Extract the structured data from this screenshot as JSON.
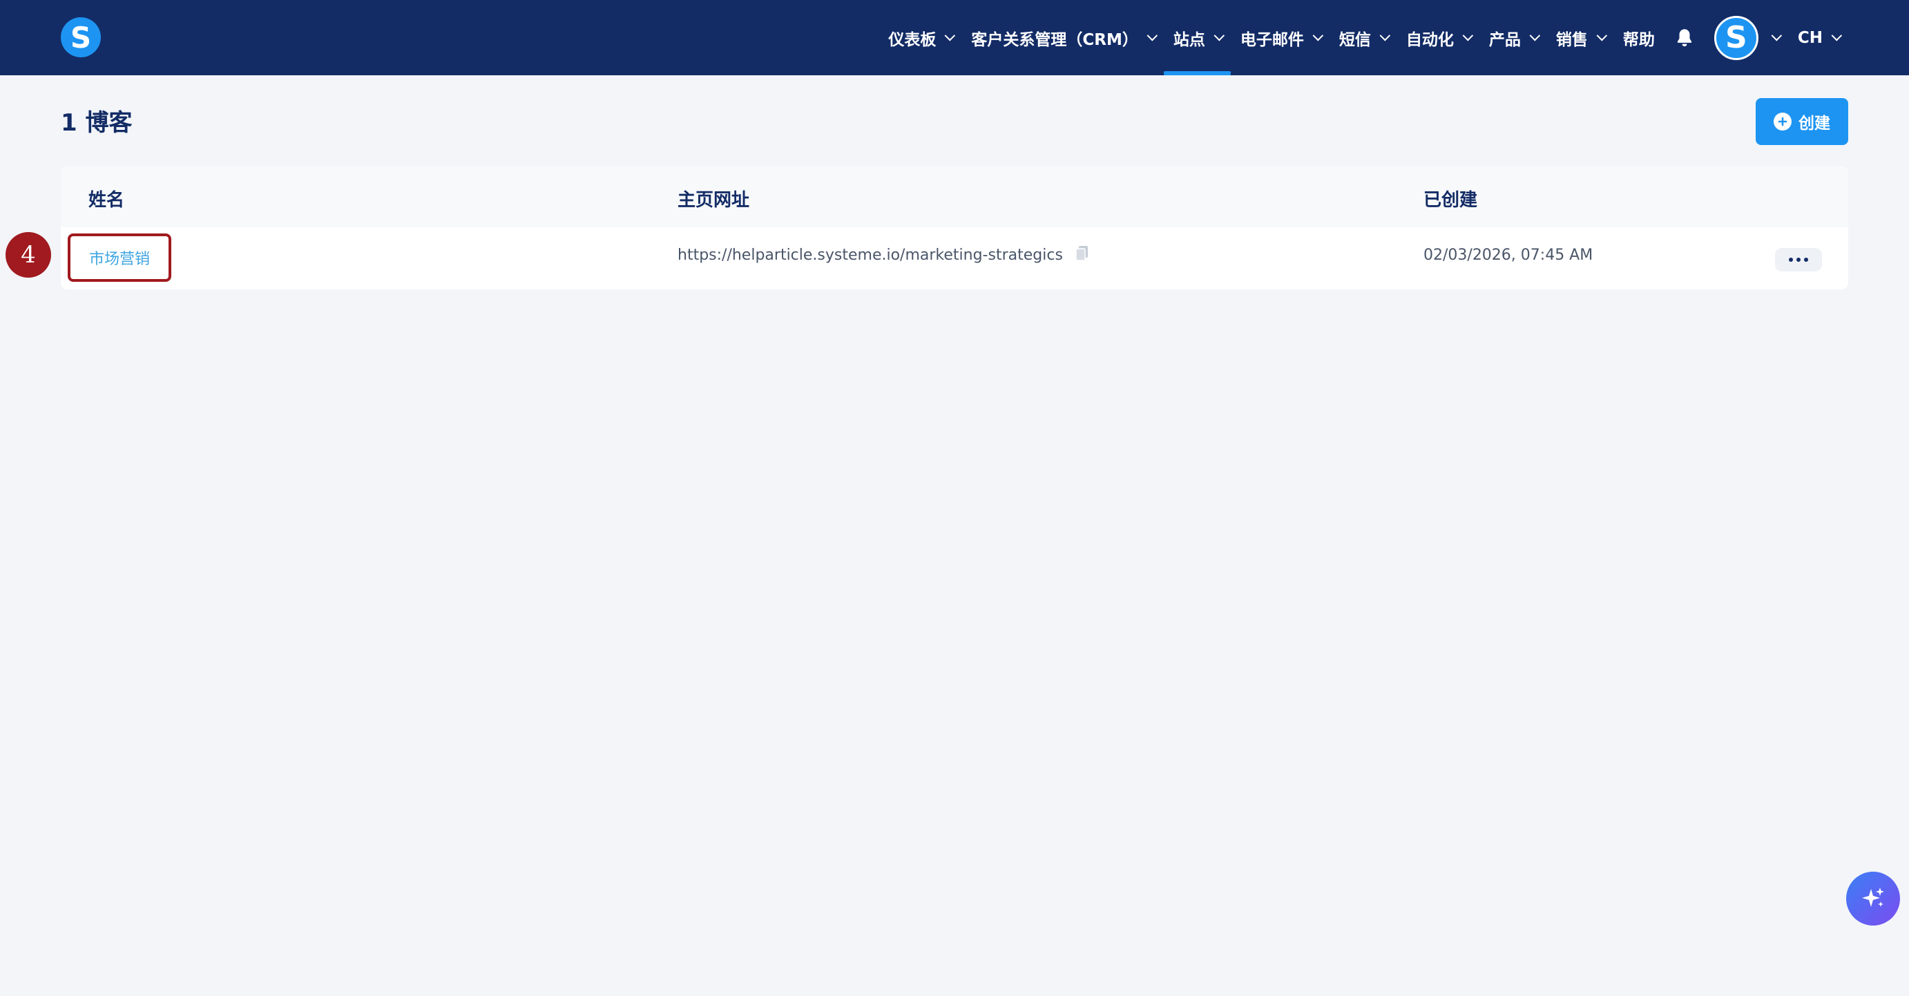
{
  "logo": {
    "letter": "S"
  },
  "nav": {
    "items": [
      {
        "label": "仪表板",
        "has_menu": true
      },
      {
        "label": "客户关系管理（CRM）",
        "has_menu": true
      },
      {
        "label": "站点",
        "has_menu": true,
        "active": true
      },
      {
        "label": "电子邮件",
        "has_menu": true
      },
      {
        "label": "短信",
        "has_menu": true
      },
      {
        "label": "自动化",
        "has_menu": true
      },
      {
        "label": "产品",
        "has_menu": true
      },
      {
        "label": "销售",
        "has_menu": true
      },
      {
        "label": "帮助",
        "has_menu": false
      }
    ],
    "avatar_letter": "S",
    "language": "CH"
  },
  "page": {
    "title": "1 博客",
    "create_label": "创建"
  },
  "table": {
    "headers": {
      "name": "姓名",
      "url": "主页网址",
      "created": "已创建"
    },
    "rows": [
      {
        "name": "市场营销",
        "url": "https://helparticle.systeme.io/marketing-strategics",
        "created": "02/03/2026, 07:45 AM"
      }
    ]
  },
  "annotation": {
    "step": "4"
  },
  "colors": {
    "nav_bg": "#132c66",
    "accent": "#1d94f2",
    "highlight": "#a01a1f",
    "link": "#3ea5e0"
  }
}
